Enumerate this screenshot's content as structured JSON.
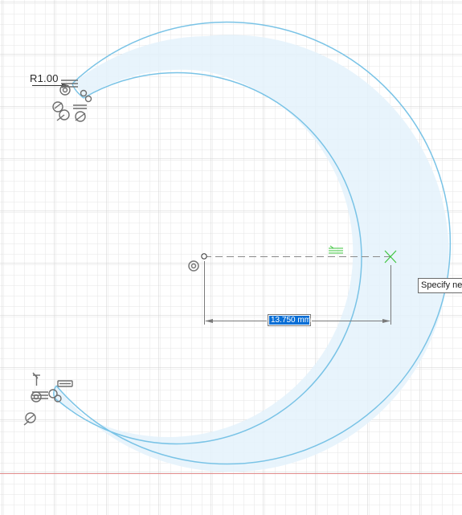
{
  "sketch": {
    "radius_dimension": "R1.00",
    "linear_dimension_value": "13.750 mm",
    "tooltip_text": "Specify ne"
  },
  "colors": {
    "grid_minor": "#e6e6e6",
    "grid_major": "#cfcfcf",
    "profile_fill": "#e4f2fb",
    "profile_stroke": "#79c3e6",
    "axis_red": "#e08a8a",
    "constraint_green": "#3ec43e",
    "dimension_line": "#7a7a7a",
    "constraint_glyph": "#6e6e6e",
    "selection_blue": "#0a6fd6"
  },
  "icons": {
    "origin": "origin-icon",
    "fix_constraint": "fix-constraint-icon",
    "parallel_constraint": "parallel-constraint-icon",
    "tangent_constraint": "tangent-constraint-icon",
    "coincident_constraint": "coincident-constraint-icon",
    "equal_constraint": "equal-constraint-icon",
    "perpendicular_constraint": "perpendicular-constraint-icon",
    "snap_point": "snap-point-icon"
  }
}
